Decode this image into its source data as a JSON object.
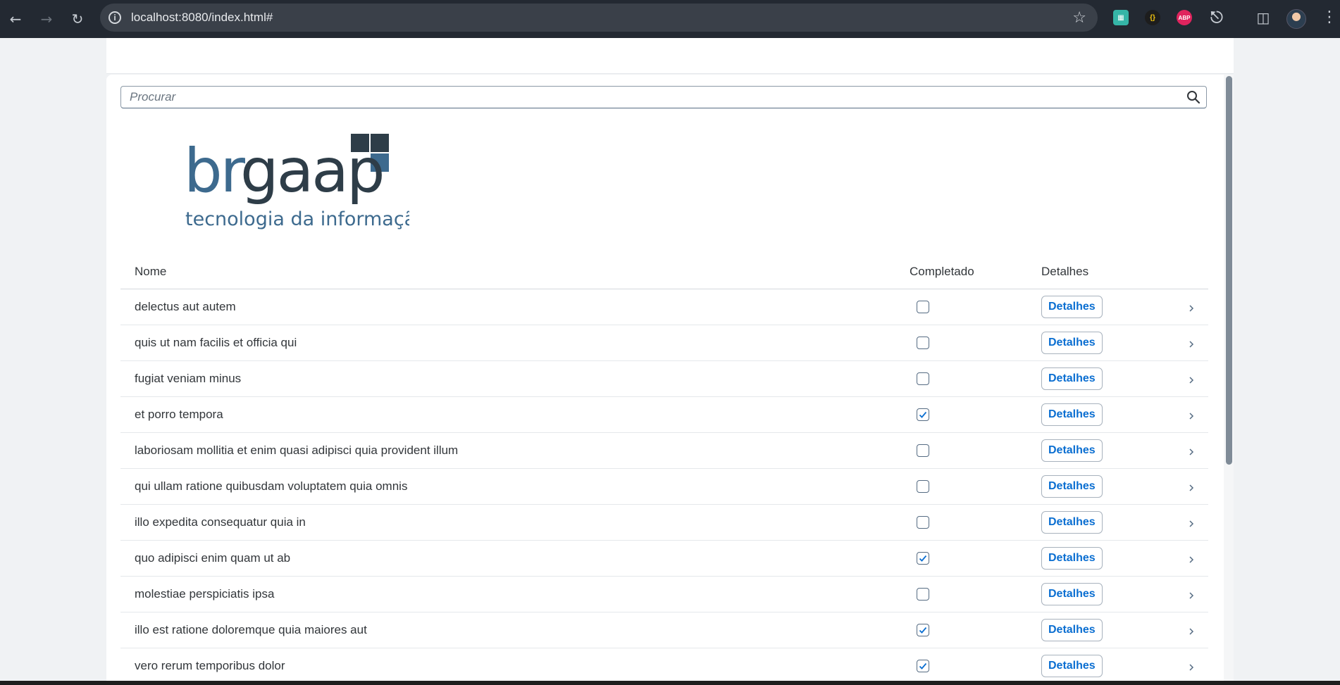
{
  "browser": {
    "url": "localhost:8080/index.html#",
    "ext_abp": "ABP",
    "ext_braces": "{}"
  },
  "search": {
    "placeholder": "Procurar"
  },
  "logo": {
    "word": "brgaap",
    "tagline": "tecnologia da informação"
  },
  "table": {
    "columns": {
      "name": "Nome",
      "completed": "Completado",
      "details": "Detalhes"
    },
    "rows": [
      {
        "name": "delectus aut autem",
        "completed": false,
        "button": "Detalhes"
      },
      {
        "name": "quis ut nam facilis et officia qui",
        "completed": false,
        "button": "Detalhes"
      },
      {
        "name": "fugiat veniam minus",
        "completed": false,
        "button": "Detalhes"
      },
      {
        "name": "et porro tempora",
        "completed": true,
        "button": "Detalhes"
      },
      {
        "name": "laboriosam mollitia et enim quasi adipisci quia provident illum",
        "completed": false,
        "button": "Detalhes"
      },
      {
        "name": "qui ullam ratione quibusdam voluptatem quia omnis",
        "completed": false,
        "button": "Detalhes"
      },
      {
        "name": "illo expedita consequatur quia in",
        "completed": false,
        "button": "Detalhes"
      },
      {
        "name": "quo adipisci enim quam ut ab",
        "completed": true,
        "button": "Detalhes"
      },
      {
        "name": "molestiae perspiciatis ipsa",
        "completed": false,
        "button": "Detalhes"
      },
      {
        "name": "illo est ratione doloremque quia maiores aut",
        "completed": true,
        "button": "Detalhes"
      },
      {
        "name": "vero rerum temporibus dolor",
        "completed": true,
        "button": "Detalhes"
      }
    ]
  },
  "colors": {
    "accent": "#0a6ed1",
    "logo_dark": "#2e3d48",
    "logo_blue": "#3d6a8e"
  }
}
